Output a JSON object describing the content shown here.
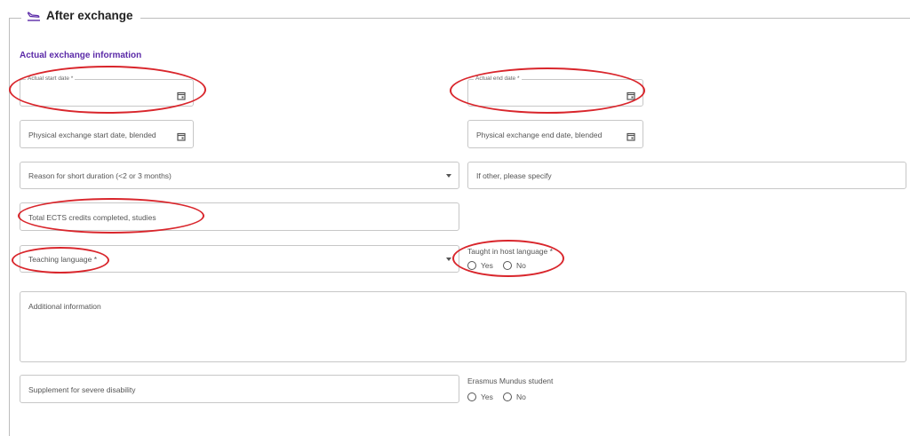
{
  "section": {
    "legend_title": "After exchange",
    "subtitle": "Actual exchange information"
  },
  "fields": {
    "actual_start_date": {
      "label": "Actual start date *",
      "value": ""
    },
    "actual_end_date": {
      "label": "Actual end date *",
      "value": ""
    },
    "physical_start_date": {
      "placeholder": "Physical exchange start date, blended"
    },
    "physical_end_date": {
      "placeholder": "Physical exchange end date, blended"
    },
    "reason_short_duration": {
      "placeholder": "Reason for short duration (<2 or 3 months)"
    },
    "if_other": {
      "placeholder": "If other, please specify"
    },
    "total_ects": {
      "placeholder": "Total ECTS credits completed, studies"
    },
    "teaching_language": {
      "placeholder": "Teaching language *"
    },
    "additional_info": {
      "placeholder": "Additional information"
    },
    "supplement_disability": {
      "placeholder": "Supplement for severe disability"
    }
  },
  "radios": {
    "taught_in_host_language": {
      "label": "Taught in host language *",
      "options": [
        "Yes",
        "No"
      ]
    },
    "erasmus_mundus": {
      "label": "Erasmus Mundus student",
      "options": [
        "Yes",
        "No"
      ]
    }
  },
  "colors": {
    "accent": "#5b2aa8",
    "annotation": "#d9262c",
    "border": "#c7c7c7"
  },
  "icons": {
    "legend_icon": "airplane-landing-icon",
    "date_icon": "calendar-icon",
    "select_icon": "caret-down-icon"
  }
}
